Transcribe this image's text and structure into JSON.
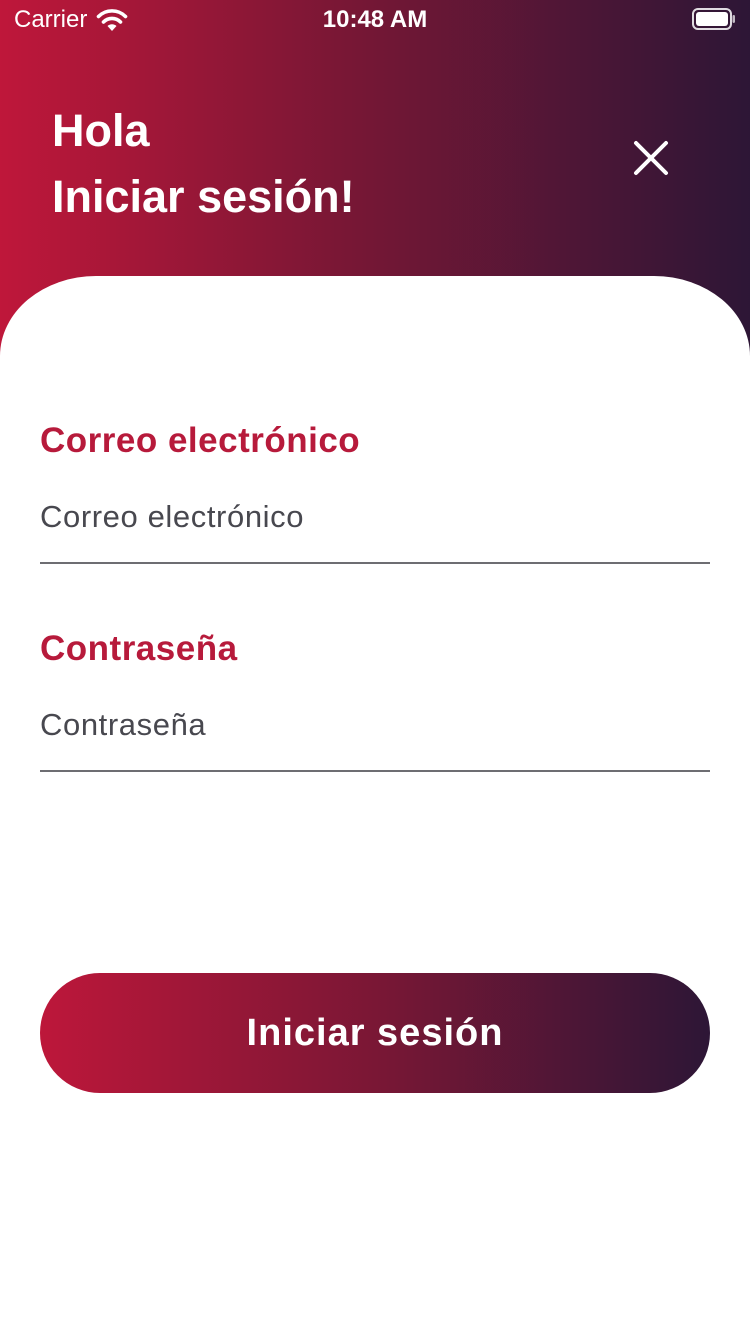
{
  "status_bar": {
    "carrier": "Carrier",
    "time": "10:48 AM",
    "wifi_icon": "wifi-icon",
    "battery_icon": "battery-icon"
  },
  "header": {
    "greeting": "Hola",
    "title": "Iniciar sesión!",
    "close_icon": "close-icon",
    "gradient_colors": [
      "#bf173a",
      "#2d1636"
    ]
  },
  "form": {
    "email": {
      "label": "Correo electrónico",
      "placeholder": "Correo electrónico",
      "value": ""
    },
    "password": {
      "label": "Contraseña",
      "placeholder": "Contraseña",
      "value": ""
    },
    "submit_label": "Iniciar sesión"
  },
  "colors": {
    "accent": "#b71a3b",
    "dark": "#2d1636",
    "background": "#ffffff"
  }
}
